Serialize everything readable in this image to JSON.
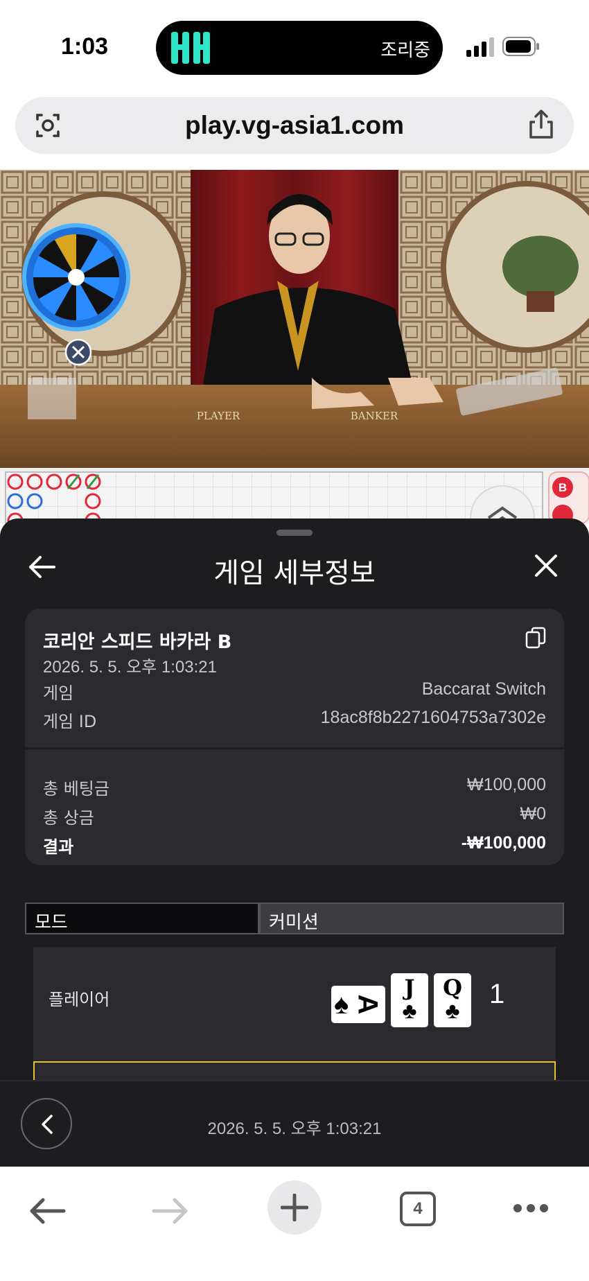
{
  "status_bar": {
    "time": "1:03",
    "island_logo": "뱅",
    "island_text": "조리중"
  },
  "browser": {
    "url": "play.vg-asia1.com",
    "tab_count": "4"
  },
  "video": {
    "table_left_label": "PLAYER",
    "table_right_label": "BANKER"
  },
  "sheet": {
    "title": "게임 세부정보",
    "table_name": "코리안 스피드 바카라 B",
    "datetime": "2026. 5. 5. 오후 1:03:21",
    "game_label": "게임",
    "game_value": "Baccarat Switch",
    "game_id_label": "게임 ID",
    "game_id_value": "18ac8f8b2271604753a7302e",
    "total_bet_label": "총 베팅금",
    "total_bet_value": "₩100,000",
    "total_win_label": "총 상금",
    "total_win_value": "₩0",
    "result_label": "결과",
    "result_value": "-₩100,000",
    "tab_mode": "모드",
    "tab_commission": "커미션",
    "player_label": "플레이어",
    "player_cards": [
      {
        "rank": "A",
        "suit": "♠"
      },
      {
        "rank": "J",
        "suit": "♣"
      },
      {
        "rank": "Q",
        "suit": "♣"
      }
    ],
    "player_score": "1",
    "footer_datetime": "2026. 5. 5. 오후 1:03:21"
  },
  "colors": {
    "sheet_bg": "#1d1d20",
    "card_bg": "#2b2b2f",
    "banker_highlight": "#e6c22a",
    "island_accent": "#2ee6c8"
  }
}
